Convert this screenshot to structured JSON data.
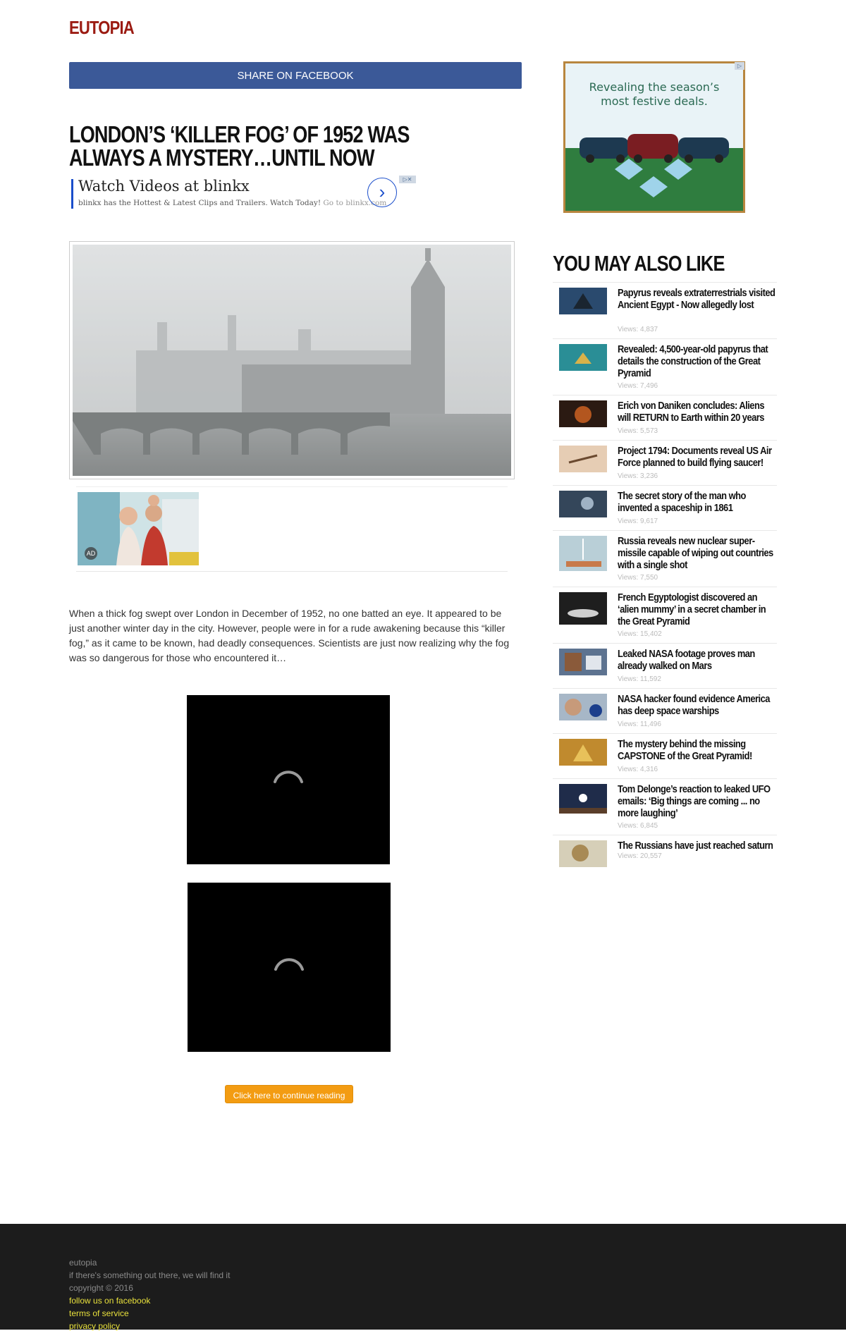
{
  "site": {
    "logo": "EUTOPIA"
  },
  "share": {
    "label": "SHARE ON FACEBOOK"
  },
  "article": {
    "title": "LONDON’S ‘KILLER FOG’ OF 1952 WAS ALWAYS A MYSTERY…UNTIL NOW",
    "intro": "When a thick fog swept over London in December of 1952, no one batted an eye. It appeared to be just another winter day in the city. However, people were in for a rude awakening because this “killer fog,” as it came to be known, had deadly consequences. Scientists are just now realizing why the fog was so dangerous for those who encountered it…",
    "continue_label": "Click here to continue reading"
  },
  "text_ad": {
    "headline": "Watch Videos at blinkx",
    "description": "blinkx has the Hottest & Latest Clips and Trailers. Watch Today!",
    "goto": "Go to blinkx.com",
    "arrow_icon": "chevron-right-icon"
  },
  "promo_ad": {
    "badge": "AD"
  },
  "side_ad": {
    "text_line1": "Revealing the season’s",
    "text_line2": "most festive deals."
  },
  "sidebar": {
    "title": "YOU MAY ALSO LIKE",
    "items": [
      {
        "headline": "Papyrus reveals extraterrestrials visited Ancient Egypt - Now allegedly lost",
        "views": "Views: 4,837"
      },
      {
        "headline": "Revealed: 4,500-year-old papyrus that details the construction of the Great Pyramid",
        "views": "Views: 7,496"
      },
      {
        "headline": "Erich von Daniken concludes: Aliens will RETURN to Earth within 20 years",
        "views": "Views: 5,573"
      },
      {
        "headline": "Project 1794: Documents reveal US Air Force planned to build flying saucer!",
        "views": "Views: 3,236"
      },
      {
        "headline": "The secret story of the man who invented a spaceship in 1861",
        "views": "Views: 9,617"
      },
      {
        "headline": "Russia reveals new nuclear super-missile capable of wiping out countries with a single shot",
        "views": "Views: 7,550"
      },
      {
        "headline": "French Egyptologist discovered an ‘alien mummy’ in a secret chamber in the Great Pyramid",
        "views": "Views: 15,402"
      },
      {
        "headline": "Leaked NASA footage proves man already walked on Mars",
        "views": "Views: 11,592"
      },
      {
        "headline": "NASA hacker found evidence America has deep space warships",
        "views": "Views: 11,496"
      },
      {
        "headline": "The mystery behind the missing CAPSTONE of the Great Pyramid!",
        "views": "Views: 4,316"
      },
      {
        "headline": "Tom Delonge’s reaction to leaked UFO emails: ‘Big things are coming ... no more laughing’",
        "views": "Views: 6,845"
      },
      {
        "headline": "The Russians have just reached saturn",
        "views": "Views: 20,557"
      }
    ]
  },
  "footer": {
    "name": "eutopia",
    "tagline": "if there's something out there, we will find it",
    "copyright": "copyright © 2016",
    "links": [
      "follow us on facebook",
      "terms of service",
      "privacy policy"
    ]
  },
  "colors": {
    "logo": "#9b1b12",
    "facebook": "#3b5998",
    "continue": "#f39c12",
    "footer_bg": "#1c1c1c",
    "footer_link": "#e8e03c"
  }
}
